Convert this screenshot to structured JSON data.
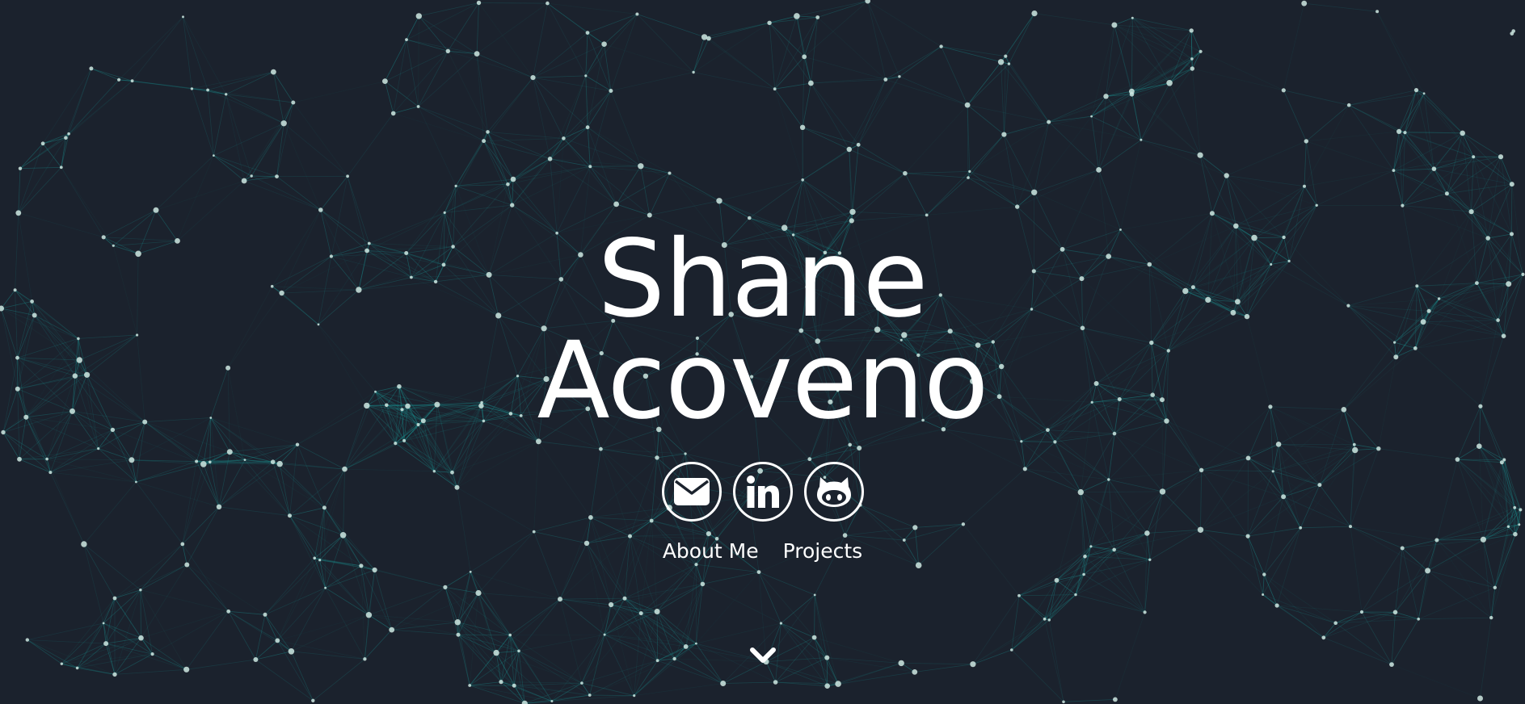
{
  "theme": {
    "background": "#1b222d",
    "network_line": "#1aa3a0",
    "network_node": "#cfe8e2",
    "foreground": "#ffffff"
  },
  "hero": {
    "first_name": "Shane",
    "last_name": "Acoveno"
  },
  "social": [
    {
      "name": "email",
      "icon": "envelope-icon"
    },
    {
      "name": "linkedin",
      "icon": "linkedin-icon",
      "glyph": "in"
    },
    {
      "name": "github",
      "icon": "github-octocat-icon"
    }
  ],
  "nav": {
    "about_label": "About Me",
    "projects_label": "Projects"
  },
  "scroll": {
    "icon": "chevron-down-icon"
  }
}
